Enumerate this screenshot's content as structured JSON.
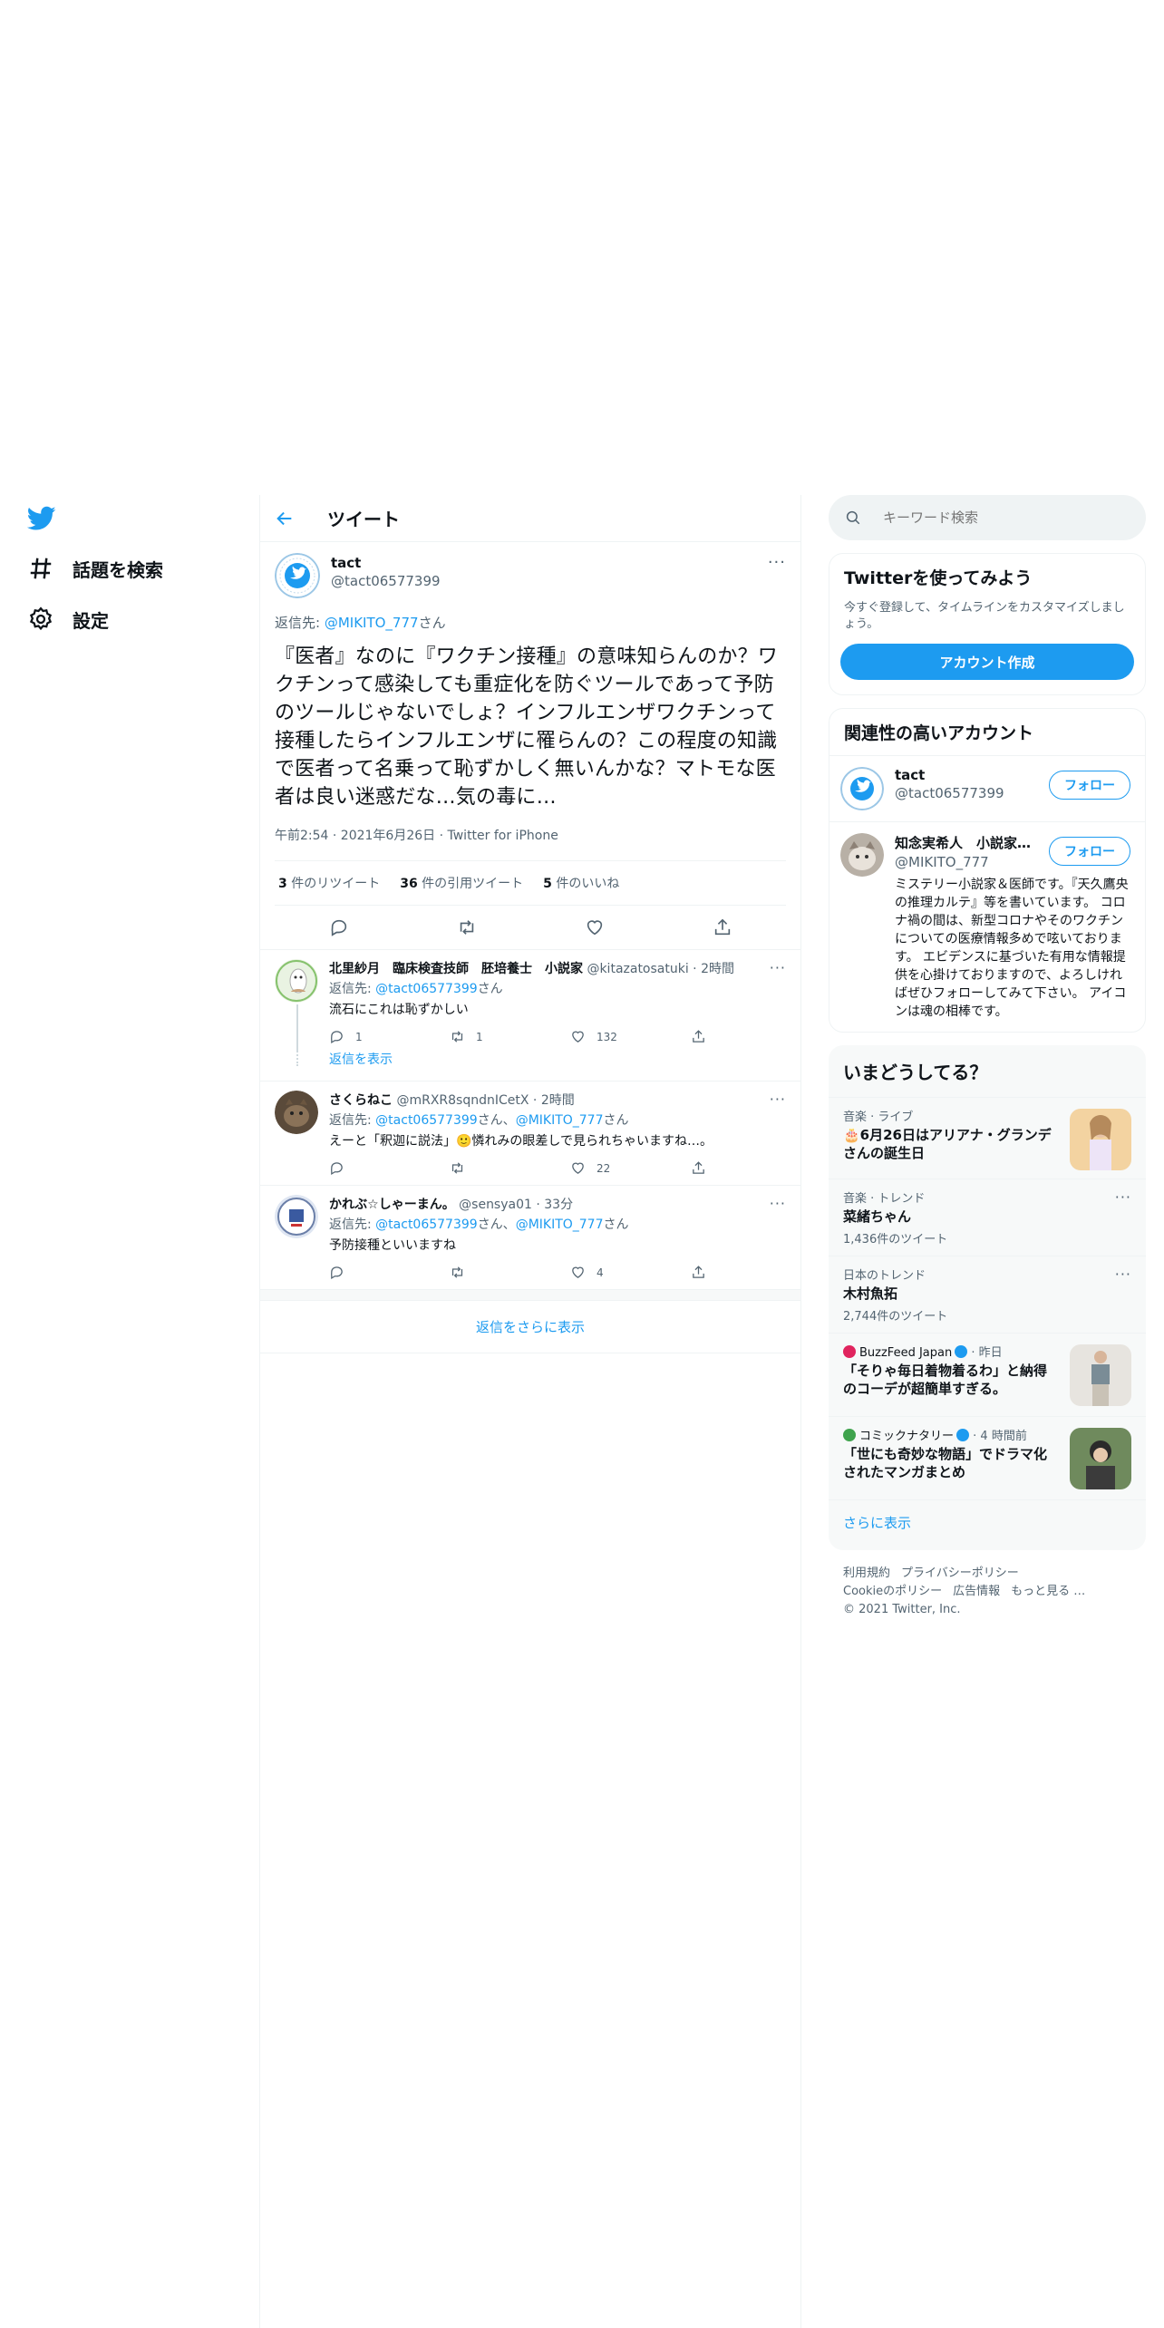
{
  "nav": {
    "explore_label": "話題を検索",
    "settings_label": "設定"
  },
  "header": {
    "title": "ツイート"
  },
  "tweet": {
    "author_name": "tact",
    "author_handle": "@tact06577399",
    "reply_prefix": "返信先: ",
    "reply_target": "@MIKITO_777",
    "reply_suffix": "さん",
    "text": "『医者』なのに『ワクチン接種』の意味知らんのか？ワクチンって感染しても重症化を防ぐツールであって予防のツールじゃないでしょ？インフルエンザワクチンって接種したらインフルエンザに罹らんの？この程度の知識で医者って名乗って恥ずかしく無いんかな？マトモな医者は良い迷惑だな…気の毒に…",
    "meta": "午前2:54 · 2021年6月26日 · Twitter for iPhone",
    "retweets_count": "3",
    "retweets_label": " 件のリツイート",
    "quotes_count": "36",
    "quotes_label": " 件の引用ツイート",
    "likes_count": "5",
    "likes_label": " 件のいいね"
  },
  "replies": [
    {
      "name": "北里紗月　臨床検査技師　胚培養士　小説家",
      "handle": "@kitazatosatuki",
      "time": " · 2時間",
      "reply_prefix": "返信先: ",
      "mention1": "@tact06577399",
      "mention_suffix1": "さん",
      "mention2": "",
      "mention_suffix2": "",
      "text": "流石にこれは恥ずかしい",
      "reply_count": "1",
      "retweet_count": "1",
      "like_count": "132"
    },
    {
      "name": "さくらねこ",
      "handle": "@mRXR8sqndnICetX",
      "time": " · 2時間",
      "reply_prefix": "返信先: ",
      "mention1": "@tact06577399",
      "mention_suffix1": "さん、",
      "mention2": "@MIKITO_777",
      "mention_suffix2": "さん",
      "text": "えーと「釈迦に説法」🙂憐れみの眼差しで見られちゃいますね…。",
      "reply_count": "",
      "retweet_count": "",
      "like_count": "22"
    },
    {
      "name": "かれぶ☆しゃーまん。",
      "handle": "@sensya01",
      "time": " · 33分",
      "reply_prefix": "返信先: ",
      "mention1": "@tact06577399",
      "mention_suffix1": "さん、",
      "mention2": "@MIKITO_777",
      "mention_suffix2": "さん",
      "text": "予防接種といいますね",
      "reply_count": "",
      "retweet_count": "",
      "like_count": "4"
    }
  ],
  "show_replies_label": "返信を表示",
  "more_replies_label": "返信をさらに表示",
  "search": {
    "placeholder": "キーワード検索"
  },
  "signup": {
    "title": "Twitterを使ってみよう",
    "subtitle": "今すぐ登録して、タイムラインをカスタマイズしましょう。",
    "button": "アカウント作成"
  },
  "related": {
    "title": "関連性の高いアカウント",
    "follow_label": "フォロー",
    "accounts": [
      {
        "name": "tact",
        "handle": "@tact06577399",
        "bio": ""
      },
      {
        "name": "知念実希人　小説家…",
        "handle": "@MIKITO_777",
        "bio": "ミステリー小説家＆医師です。『天久鷹央の推理カルテ』等を書いています。 コロナ禍の間は、新型コロナやそのワクチンについての医療情報多めで呟いております。 エビデンスに基づいた有用な情報提供を心掛けておりますので、よろしければぜひフォローしてみて下さい。 アイコンは魂の相棒です。"
      }
    ]
  },
  "trends": {
    "title": "いまどうしてる？",
    "items": [
      {
        "category": "音楽 · ライブ",
        "title": "🎂6月26日はアリアナ・グランデさんの誕生日",
        "count": "",
        "source": ""
      },
      {
        "category": "音楽 · トレンド",
        "title": "菜緒ちゃん",
        "count": "1,436件のツイート",
        "source": ""
      },
      {
        "category": "日本のトレンド",
        "title": "木村魚拓",
        "count": "2,744件のツイート",
        "source": ""
      },
      {
        "category": "",
        "title": "「そりゃ毎日着物着るわ」と納得のコーデが超簡単すぎる。",
        "count": "",
        "source": "BuzzFeed Japan",
        "time": " · 昨日"
      },
      {
        "category": "",
        "title": "「世にも奇妙な物語」でドラマ化されたマンガまとめ",
        "count": "",
        "source": "コミックナタリー",
        "time": " · 4 時間前"
      }
    ],
    "show_more": "さらに表示"
  },
  "footer": {
    "terms": "利用規約",
    "privacy": "プライバシーポリシー",
    "cookie": "Cookieのポリシー",
    "ads": "広告情報",
    "more": "もっと見る …",
    "copyright": "© 2021 Twitter, Inc."
  },
  "colors": {
    "accent": "#1d9bf0",
    "text": "#0f1419",
    "secondary": "#536471",
    "border": "#eff3f4"
  }
}
